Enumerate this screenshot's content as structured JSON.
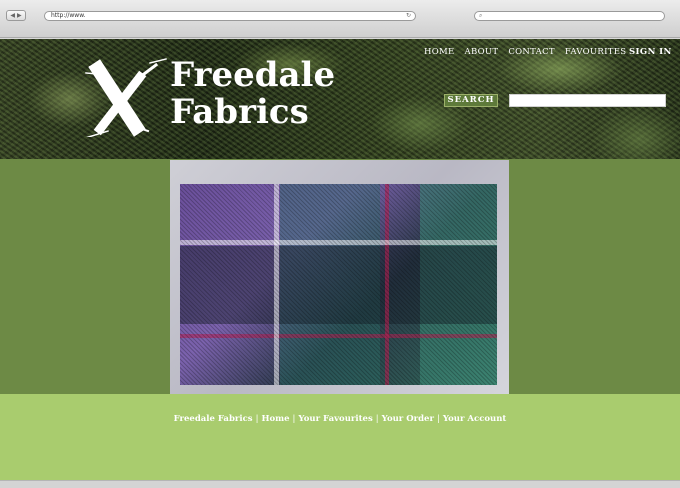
{
  "browser": {
    "url": "http://www.",
    "reload_icon": "reload-icon",
    "search_placeholder": ""
  },
  "site": {
    "logo_line1": "Freedale",
    "logo_line2": "Fabrics",
    "nav": [
      "HOME",
      "ABOUT",
      "CONTACT",
      "FAVOURITES"
    ],
    "sign_in": "SIGN IN",
    "search_label": "SEARCH",
    "search_value": ""
  },
  "footer": {
    "links": [
      "Freedale Fabrics",
      "Home",
      "Your Favourites",
      "Your Order",
      "Your Account"
    ],
    "separator": "|"
  },
  "colors": {
    "header_green": "#3f4d2a",
    "main_green": "#6d8a45",
    "footer_green": "#a9cc6e",
    "search_button": "#5e7a3a"
  }
}
